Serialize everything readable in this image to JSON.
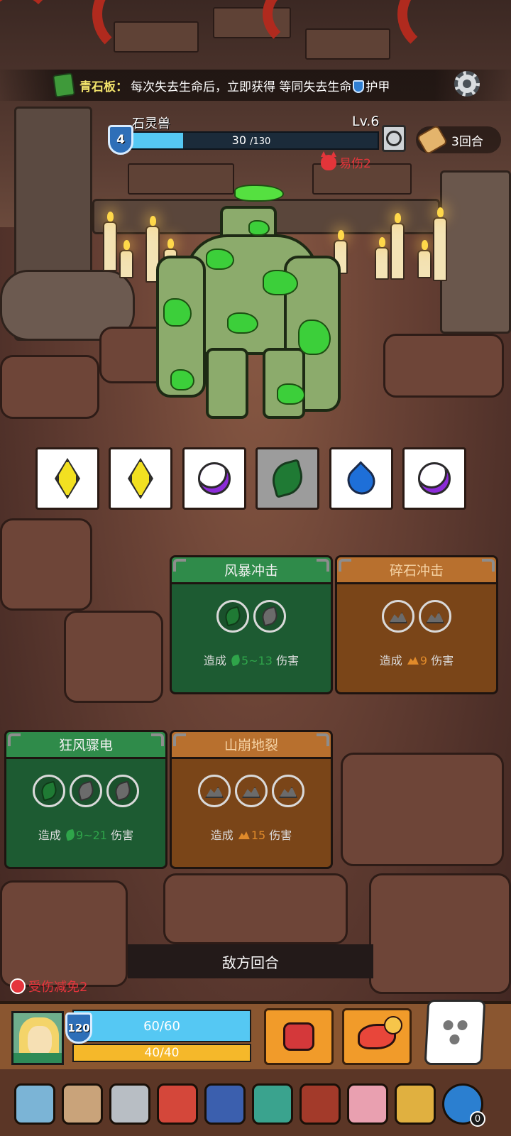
{
  "buff": {
    "name": "青石板：",
    "desc_pre": "每次失去生命后，立即获得 等同失去生命",
    "desc_post": "护甲"
  },
  "enemy": {
    "name": "石灵兽",
    "level": "Lv.6",
    "shield": "4",
    "hp_current": "30",
    "hp_max": "/130",
    "hp_fraction": 0.23,
    "status": "易伤2"
  },
  "turn": {
    "label": "3回合"
  },
  "dice_symbols": [
    "diamond",
    "diamond",
    "moon",
    "leaf-used",
    "drop",
    "moon"
  ],
  "skills": [
    {
      "title": "风暴冲击",
      "color": "green",
      "slots": 2,
      "filled": 1,
      "dmg_pre": "造成",
      "dmg_val": "5~13",
      "dmg_post": "伤害"
    },
    {
      "title": "碎石冲击",
      "color": "brown",
      "slots": 2,
      "filled": 0,
      "dmg_pre": "造成",
      "dmg_val": "9",
      "dmg_post": "伤害"
    },
    {
      "title": "狂风骤电",
      "color": "green",
      "slots": 3,
      "filled": 1,
      "dmg_pre": "造成",
      "dmg_val": "9~21",
      "dmg_post": "伤害"
    },
    {
      "title": "山崩地裂",
      "color": "brown",
      "slots": 3,
      "filled": 0,
      "dmg_pre": "造成",
      "dmg_val": "15",
      "dmg_post": "伤害"
    }
  ],
  "enemy_turn_label": "敌方回合",
  "player": {
    "status": "受伤减免2",
    "shield": "120",
    "hp": "60/60",
    "mp": "40/40"
  },
  "inventory_badge": "0",
  "colors": {
    "green_card": "#1d5b32",
    "brown_card": "#7a4518",
    "hp_blue": "#55c8f3",
    "mp_yellow": "#f5b82a",
    "danger_red": "#e3353a"
  }
}
